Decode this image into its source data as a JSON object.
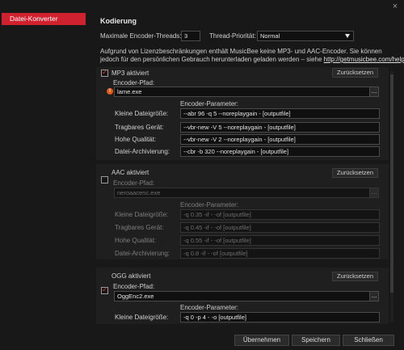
{
  "window": {
    "close_glyph": "×"
  },
  "sidebar": {
    "items": [
      {
        "label": "Datei-Konverter",
        "active": true
      }
    ]
  },
  "section_title": "Kodierung",
  "threads": {
    "label": "Maximale Encoder-Threads:",
    "value": "3"
  },
  "priority": {
    "label": "Thread-Priorität:",
    "value": "Normal"
  },
  "notice": {
    "line1": "Aufgrund von Lizenzbeschränkungen enthält MusicBee keine MP3- und AAC-Encoder. Sie können",
    "line2_prefix": "jedoch für den persönlichen Gebrauch herunterladen geladen werden – siehe",
    "link": "http://getmusicbee.com/help.htm"
  },
  "encoders": [
    {
      "enabled_label": "MP3 aktiviert",
      "enabled": true,
      "reset_label": "Zurücksetzen",
      "path_label": "Encoder-Pfad:",
      "path_value": "lame.exe",
      "browse": "...",
      "params_label": "Encoder-Parameter:",
      "rows": [
        {
          "label": "Kleine Dateigröße:",
          "value": "--abr 96 -q 5 --noreplaygain - [outputfile]"
        },
        {
          "label": "Tragbares Gerät:",
          "value": "--vbr-new -V 5 --noreplaygain - [outputfile]"
        },
        {
          "label": "Hohe Qualität:",
          "value": "--vbr-new -V 2 --noreplaygain - [outputfile]"
        },
        {
          "label": "Datei-Archivierung:",
          "value": "--cbr -b 320 --noreplaygain - [outputfile]"
        }
      ]
    },
    {
      "enabled_label": "AAC aktiviert",
      "enabled": false,
      "reset_label": "Zurücksetzen",
      "path_label": "Encoder-Pfad:",
      "path_value": "neroaacenc.exe",
      "browse": "...",
      "params_label": "Encoder-Parameter:",
      "rows": [
        {
          "label": "Kleine Dateigröße:",
          "value": "-q 0.35 -if - -of [outputfile]"
        },
        {
          "label": "Tragbares Gerät:",
          "value": "-q 0.45 -if - -of [outputfile]"
        },
        {
          "label": "Hohe Qualität:",
          "value": "-q 0.55 -if - -of [outputfile]"
        },
        {
          "label": "Datei-Archivierung:",
          "value": "-q 0.8 -if - -of [outputfile]"
        }
      ]
    },
    {
      "enabled_label": "OGG aktiviert",
      "enabled": true,
      "reset_label": "Zurücksetzen",
      "path_label": "Encoder-Pfad:",
      "path_value": "OggEnc2.exe",
      "browse": "...",
      "params_label": "Encoder-Parameter:",
      "rows": [
        {
          "label": "Kleine Dateigröße:",
          "value": "-q 0 -p 4 - -o [outputfile]"
        }
      ]
    }
  ],
  "footer": {
    "apply": "Übernehmen",
    "save": "Speichern",
    "close": "Schließen"
  },
  "colors": {
    "accent": "#d0212f",
    "background": "#181818",
    "panel": "#1f1f1f"
  }
}
